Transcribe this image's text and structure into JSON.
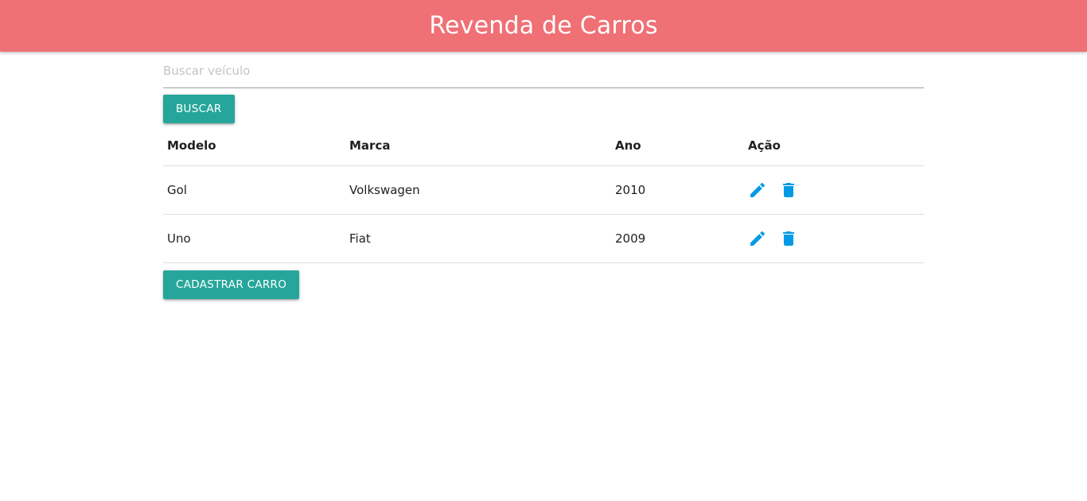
{
  "header": {
    "title": "Revenda de Carros"
  },
  "search": {
    "placeholder": "Buscar veículo",
    "value": "",
    "button_label": "BUSCAR"
  },
  "table": {
    "columns": [
      "Modelo",
      "Marca",
      "Ano",
      "Ação"
    ],
    "rows": [
      {
        "modelo": "Gol",
        "marca": "Volkswagen",
        "ano": "2010"
      },
      {
        "modelo": "Uno",
        "marca": "Fiat",
        "ano": "2009"
      }
    ],
    "action_icons": [
      "edit-icon",
      "delete-icon"
    ]
  },
  "add_button_label": "CADASTRAR CARRO",
  "colors": {
    "header_bg": "#ef7075",
    "button_bg": "#26a69a",
    "icon_color": "#039be5"
  }
}
